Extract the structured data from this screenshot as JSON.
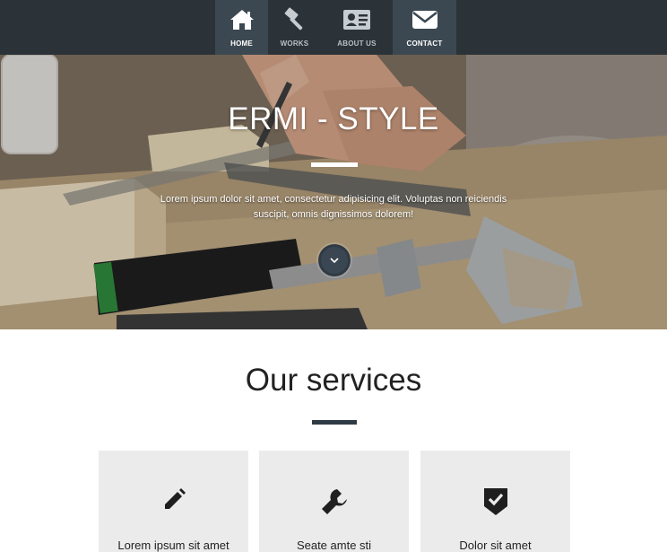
{
  "nav": {
    "items": [
      {
        "label": "HOME",
        "icon": "home-icon",
        "active": true
      },
      {
        "label": "WORKS",
        "icon": "hammer-icon",
        "active": false
      },
      {
        "label": "ABOUT US",
        "icon": "id-card-icon",
        "active": false
      },
      {
        "label": "CONTACT",
        "icon": "envelope-icon",
        "active": true
      }
    ]
  },
  "hero": {
    "title": "ERMI - STYLE",
    "text": "Lorem ipsum dolor sit amet, consectetur adipisicing elit. Voluptas non reiciendis suscipit, omnis dignissimos dolorem!",
    "scroll_icon": "chevron-down-icon"
  },
  "services": {
    "title": "Our services",
    "cards": [
      {
        "label": "Lorem ipsum sit amet",
        "icon": "pencil-icon"
      },
      {
        "label": "Seate amte sti",
        "icon": "wrench-icon"
      },
      {
        "label": "Dolor sit amet",
        "icon": "shield-check-icon"
      }
    ]
  },
  "colors": {
    "topbar": "#2b3238",
    "nav_active": "#3c4851",
    "accent_bar": "#2f3b44",
    "card_bg": "#ebebeb"
  }
}
